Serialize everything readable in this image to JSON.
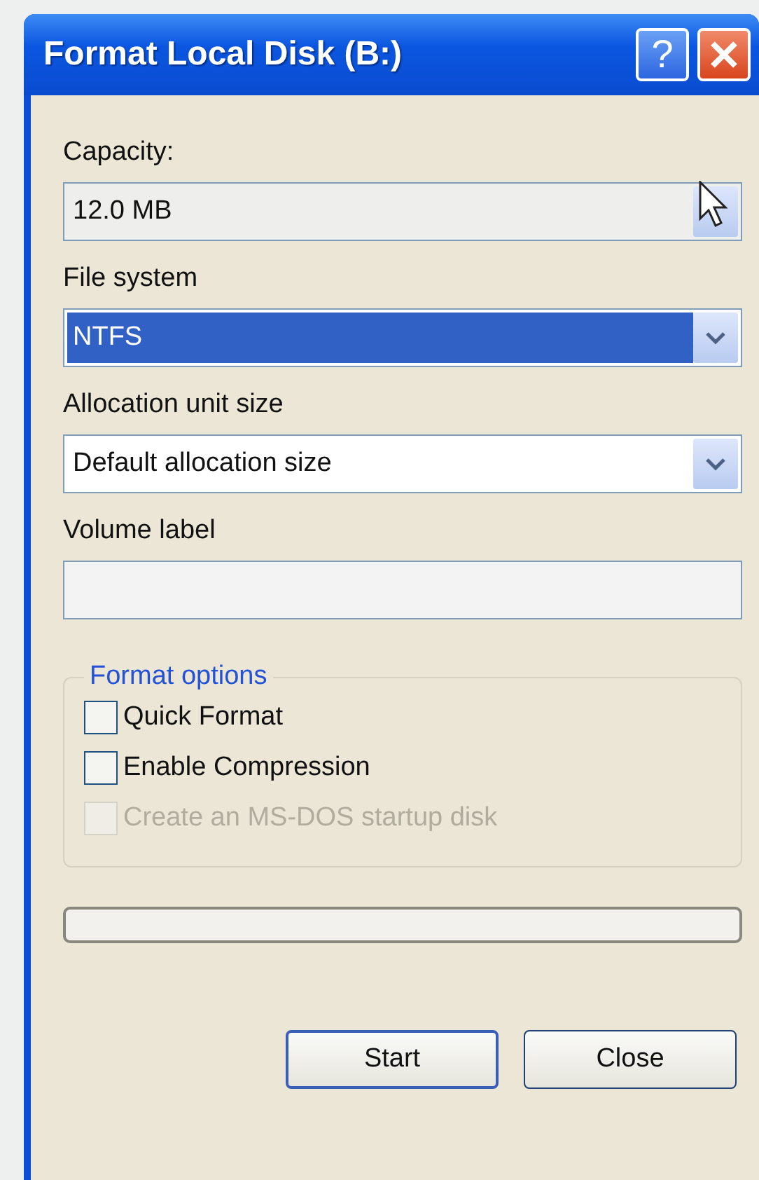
{
  "window": {
    "title": "Format Local Disk (B:)",
    "help_button": "?"
  },
  "fields": [
    {
      "kind": "combo",
      "label": "Capacity:",
      "value": "12.0 MB",
      "selected": false,
      "disabled": true
    },
    {
      "kind": "combo",
      "label": "File system",
      "value": "NTFS",
      "selected": true,
      "disabled": false
    },
    {
      "kind": "combo",
      "label": "Allocation unit size",
      "value": "Default allocation size",
      "selected": false,
      "disabled": false
    },
    {
      "kind": "text",
      "label": "Volume label"
    }
  ],
  "format_options": {
    "title": "Format options",
    "options": [
      {
        "label": "Quick Format",
        "checked": false,
        "disabled": false
      },
      {
        "label": "Enable Compression",
        "checked": false,
        "disabled": false
      },
      {
        "label": "Create an MS-DOS startup disk",
        "checked": false,
        "disabled": true
      }
    ]
  },
  "buttons": [
    {
      "label": "Start",
      "default": true
    },
    {
      "label": "Close",
      "default": false
    }
  ]
}
